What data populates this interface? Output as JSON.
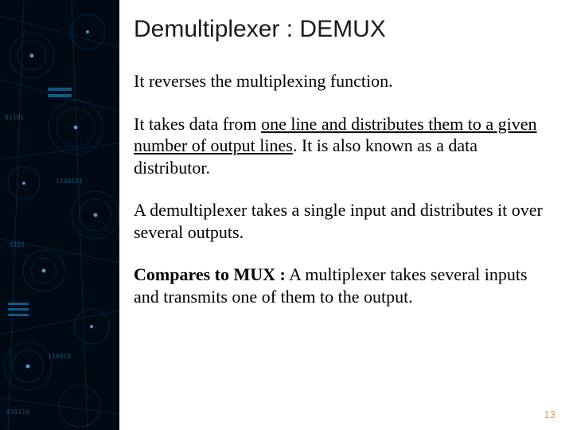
{
  "title": "Demultiplexer : DEMUX",
  "p1": "It reverses  the multiplexing function.",
  "p2_a": "It takes data from ",
  "p2_u": "one line and distributes them to a given number of output lines",
  "p2_b": ". It is also known as a data distributor.",
  "p3": "A demultiplexer takes a single input and distributes  it over several outputs.",
  "p4_label": "Compares to MUX :",
  "p4_rest": "  A multiplexer takes several inputs and transmits one of them to the output.",
  "page_number": "13"
}
